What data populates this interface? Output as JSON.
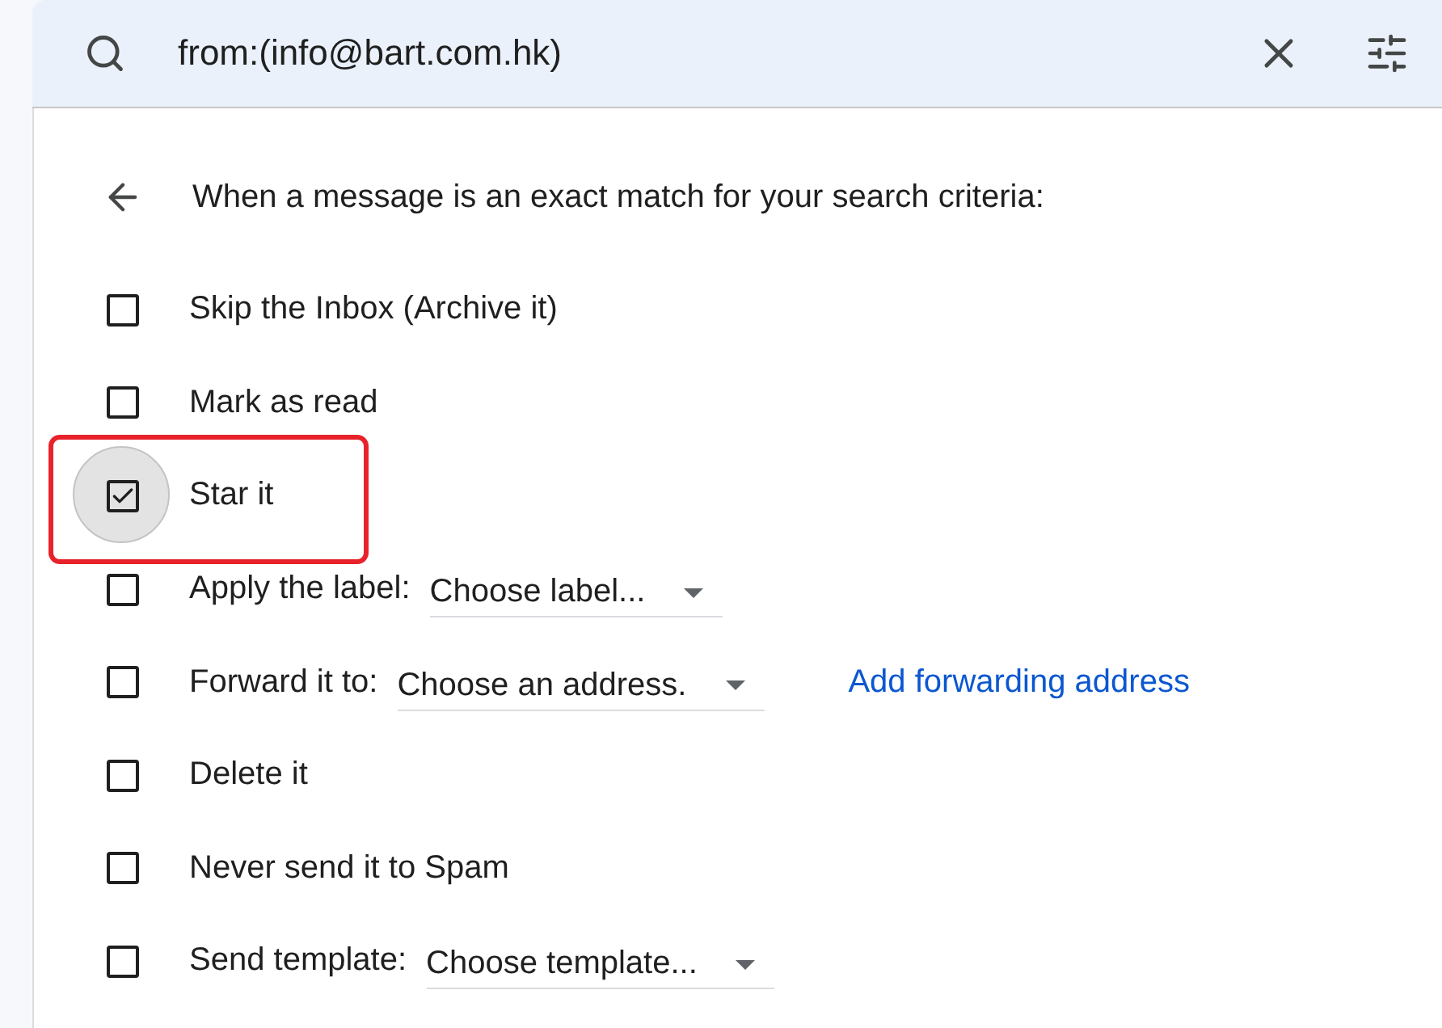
{
  "search": {
    "query": "from:(info@bart.com.hk)"
  },
  "filter_panel": {
    "heading": "When a message is an exact match for your search criteria:",
    "options": [
      {
        "kind": "plain",
        "label": "Skip the Inbox (Archive it)",
        "checked": false,
        "highlighted": false
      },
      {
        "kind": "plain",
        "label": "Mark as read",
        "checked": false,
        "highlighted": false
      },
      {
        "kind": "plain",
        "label": "Star it",
        "checked": true,
        "highlighted": true
      },
      {
        "kind": "select",
        "label": "Apply the label:",
        "select": "Choose label...",
        "checked": false,
        "highlighted": false
      },
      {
        "kind": "select",
        "label": "Forward it to:",
        "select": "Choose an address.",
        "link": "Add forwarding address",
        "checked": false,
        "highlighted": false
      },
      {
        "kind": "plain",
        "label": "Delete it",
        "checked": false,
        "highlighted": false
      },
      {
        "kind": "plain",
        "label": "Never send it to Spam",
        "checked": false,
        "highlighted": false
      },
      {
        "kind": "select",
        "label": "Send template:",
        "select": "Choose template...",
        "checked": false,
        "highlighted": false
      }
    ]
  }
}
